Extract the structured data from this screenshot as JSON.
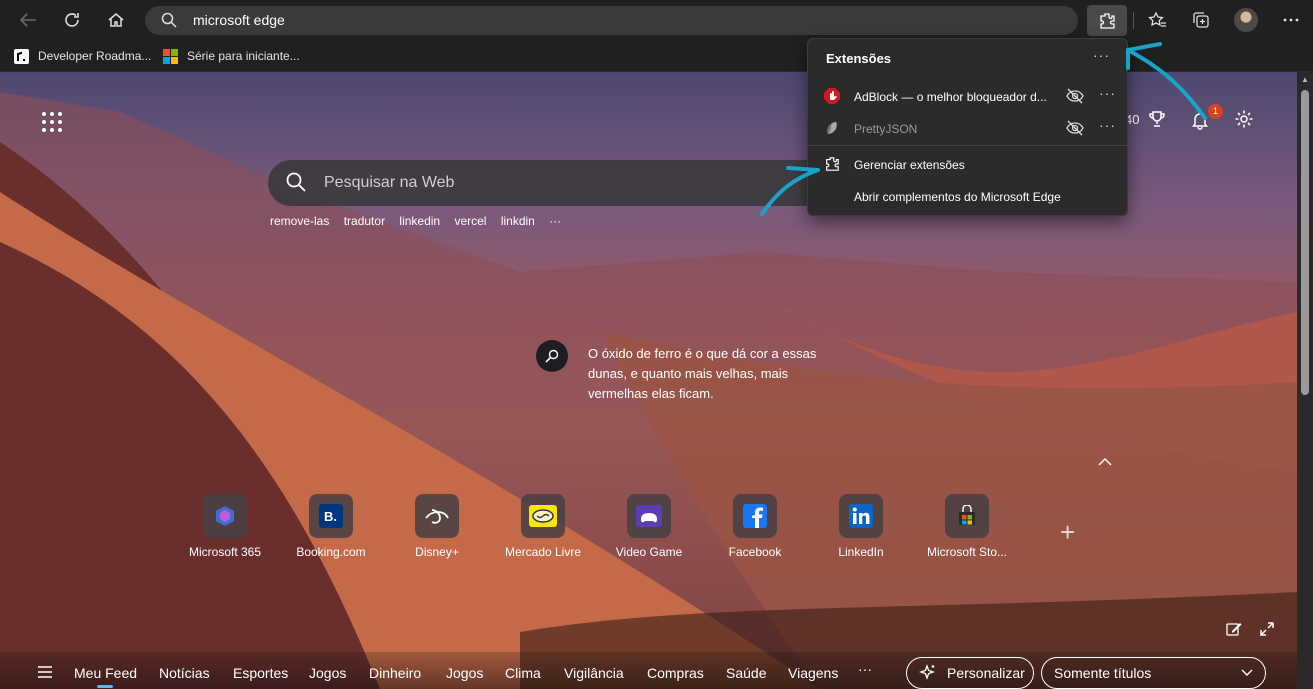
{
  "browser": {
    "address": "microsoft edge",
    "bookmarks": [
      {
        "label": "Developer Roadma..."
      },
      {
        "label": "Série para iniciante..."
      }
    ]
  },
  "extensions_popup": {
    "title": "Extensões",
    "items": [
      {
        "label": "AdBlock — o melhor bloqueador d...",
        "icon": "adblock-icon"
      },
      {
        "label": "PrettyJSON",
        "icon": "prettyjson-icon"
      }
    ],
    "manage_label": "Gerenciar extensões",
    "addons_label": "Abrir complementos do Microsoft Edge"
  },
  "newtab": {
    "search_placeholder": "Pesquisar na Web",
    "chips": [
      "remove-las",
      "tradutor",
      "linkedin",
      "vercel",
      "linkdin"
    ],
    "chips_more": "···",
    "rewards_points_partial": "40",
    "notification_count": "1",
    "fact_text": "O óxido de ferro é o que dá cor a essas dunas, e quanto mais velhas, mais vermelhas elas ficam.",
    "quick_links": [
      {
        "label": "Microsoft 365",
        "icon": "microsoft365-icon"
      },
      {
        "label": "Booking.com",
        "icon": "booking-icon"
      },
      {
        "label": "Disney+",
        "icon": "disney-icon"
      },
      {
        "label": "Mercado Livre",
        "icon": "mercadolivre-icon"
      },
      {
        "label": "Video Game",
        "icon": "videogame-icon"
      },
      {
        "label": "Facebook",
        "icon": "facebook-icon"
      },
      {
        "label": "LinkedIn",
        "icon": "linkedin-icon"
      },
      {
        "label": "Microsoft Sto...",
        "icon": "microsoft-store-icon"
      }
    ],
    "add_label": "+"
  },
  "feed": {
    "items": [
      "Meu Feed",
      "Notícias",
      "Esportes",
      "Jogos",
      "Dinheiro",
      "Jogos",
      "Clima",
      "Vigilância",
      "Compras",
      "Saúde",
      "Viagens"
    ],
    "more": "···",
    "personalize_label": "Personalizar",
    "layout_select": "Somente títulos"
  },
  "colors": {
    "accent": "#5fb3ff",
    "annotation_arrow": "#1aa3c8",
    "badge": "#d7431f"
  }
}
